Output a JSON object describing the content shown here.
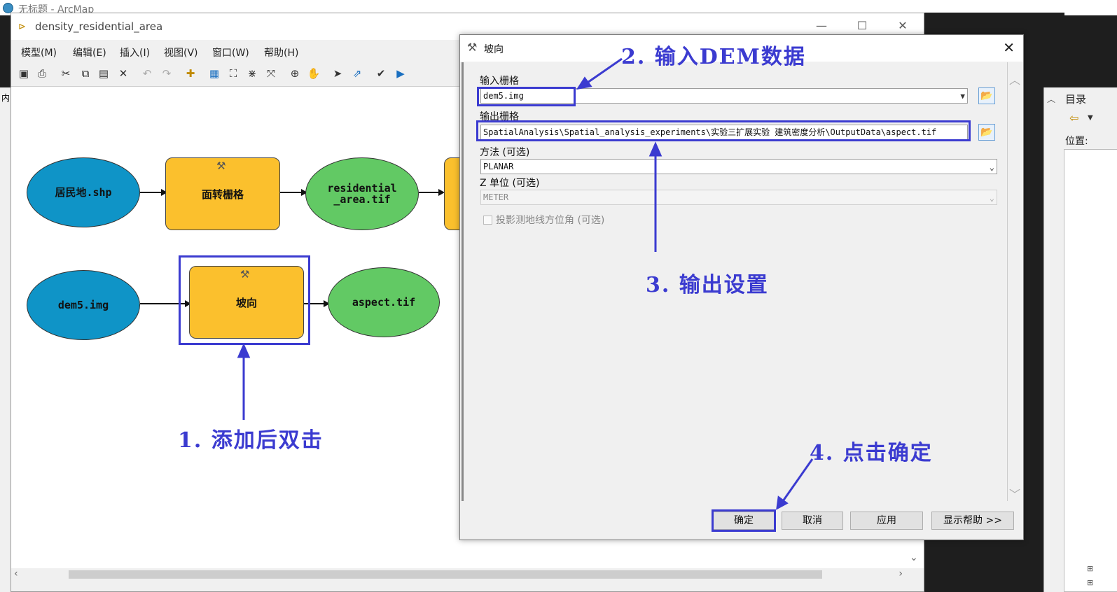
{
  "arcmap": {
    "title": "无标题 - ArcMap"
  },
  "model_window": {
    "title": "density_residential_area",
    "window_controls": {
      "minimize": "—",
      "maximize": "☐",
      "close": "✕"
    },
    "menu": [
      "模型(M)",
      "编辑(E)",
      "插入(I)",
      "视图(V)",
      "窗口(W)",
      "帮助(H)"
    ],
    "toolbar_icons": [
      "save-icon",
      "print-icon",
      "cut-icon",
      "copy-icon",
      "paste-icon",
      "delete-icon",
      "undo-icon",
      "redo-icon",
      "add-data-icon",
      "auto-layout-icon",
      "full-extent-icon",
      "zoom-in-fixed-icon",
      "zoom-out-fixed-icon",
      "zoom-in-icon",
      "pan-icon",
      "select-icon",
      "connect-icon",
      "validate-icon",
      "run-icon"
    ],
    "nodes": {
      "row1": {
        "input": "居民地.shp",
        "tool": "面转栅格",
        "output_line1": "residential",
        "output_line2": "_area.tif"
      },
      "row2": {
        "input": "dem5.img",
        "tool": "坡向",
        "output": "aspect.tif"
      }
    }
  },
  "dialog": {
    "title": "坡向",
    "close": "✕",
    "input_raster_label": "输入栅格",
    "input_raster_value": "dem5.img",
    "output_raster_label": "输出栅格",
    "output_raster_value": "SpatialAnalysis\\Spatial_analysis_experiments\\实验三扩展实验 建筑密度分析\\OutputData\\aspect.tif",
    "method_label": "方法 (可选)",
    "method_value": "PLANAR",
    "z_unit_label": "Z 单位 (可选)",
    "z_unit_value": "METER",
    "checkbox_label": "投影测地线方位角 (可选)",
    "checkbox_checked": false,
    "buttons": {
      "ok": "确定",
      "cancel": "取消",
      "apply": "应用",
      "help": "显示帮助 >>"
    }
  },
  "catalog": {
    "header": "目录",
    "location_label": "位置:"
  },
  "left_panel": {
    "label": "内"
  },
  "annotations": {
    "step1": "1. 添加后双击",
    "step2": "2. 输入DEM数据",
    "step3": "3. 输出设置",
    "step4": "4. 点击确定"
  },
  "colors": {
    "annotation": "#3b3bd0",
    "input_node": "#0f94c7",
    "tool_node": "#fbc02d",
    "output_node": "#62c964"
  }
}
